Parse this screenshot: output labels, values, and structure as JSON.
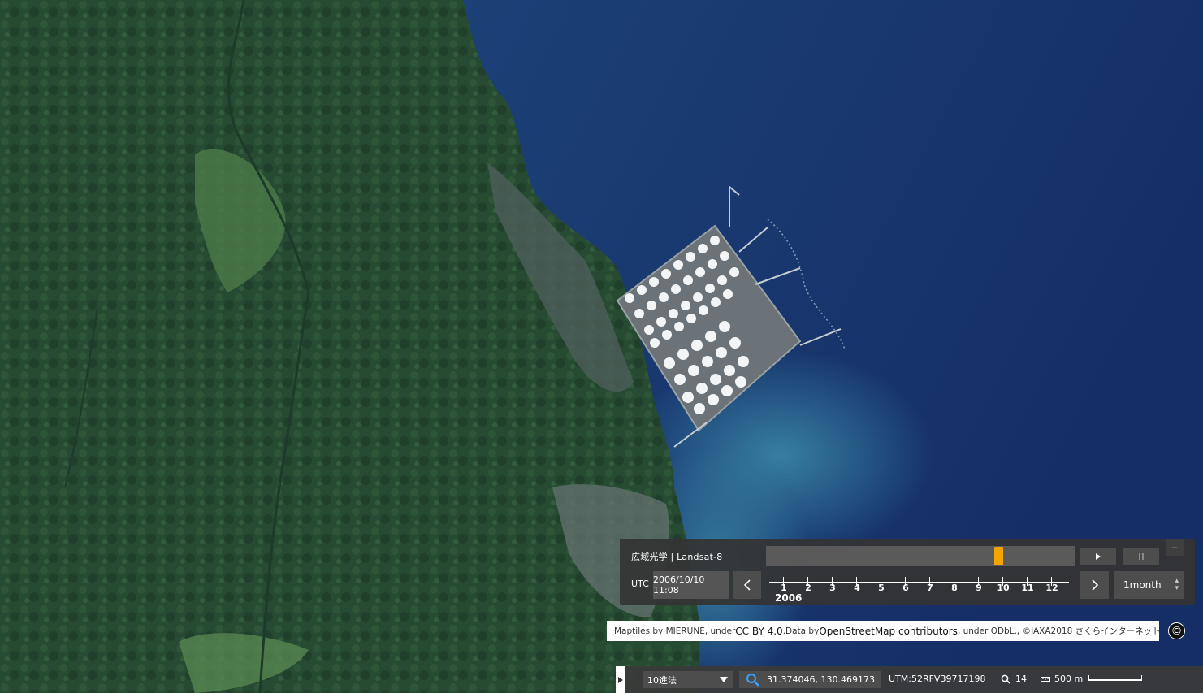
{
  "map": {
    "layer_name": "広域光学 | Landsat-8",
    "time": {
      "utc_label": "UTC",
      "datetime": "2006/10/10 11:08",
      "slider_position": 0.76,
      "year_label": "2006",
      "month_labels": [
        "1",
        "2",
        "3",
        "4",
        "5",
        "6",
        "7",
        "8",
        "9",
        "10",
        "11",
        "12"
      ],
      "interval": "1month",
      "prev_icon": "chevron-left-icon",
      "next_icon": "chevron-right-icon",
      "play_icon": "play-icon",
      "pause_icon": "pause-icon",
      "minimize_label": "–",
      "accent_color": "#f5a400"
    },
    "attribution": {
      "part1": "Maptiles by MIERUNE, under ",
      "link1": "CC BY 4.0",
      "part2": ".Data by ",
      "link2": "OpenStreetMap contributors",
      "part3": ", under ODbL., ©JAXA2018 さくらインターネット",
      "copyright_symbol": "©"
    },
    "status": {
      "coord_format": "10進法",
      "coordinates": "31.374046, 130.469173",
      "utm": "UTM:52RFV39717198",
      "zoom": "14",
      "scale": "500 m"
    },
    "colors": {
      "sea": "#1b3f73",
      "land": "#274a33",
      "panel": "#343434"
    }
  }
}
